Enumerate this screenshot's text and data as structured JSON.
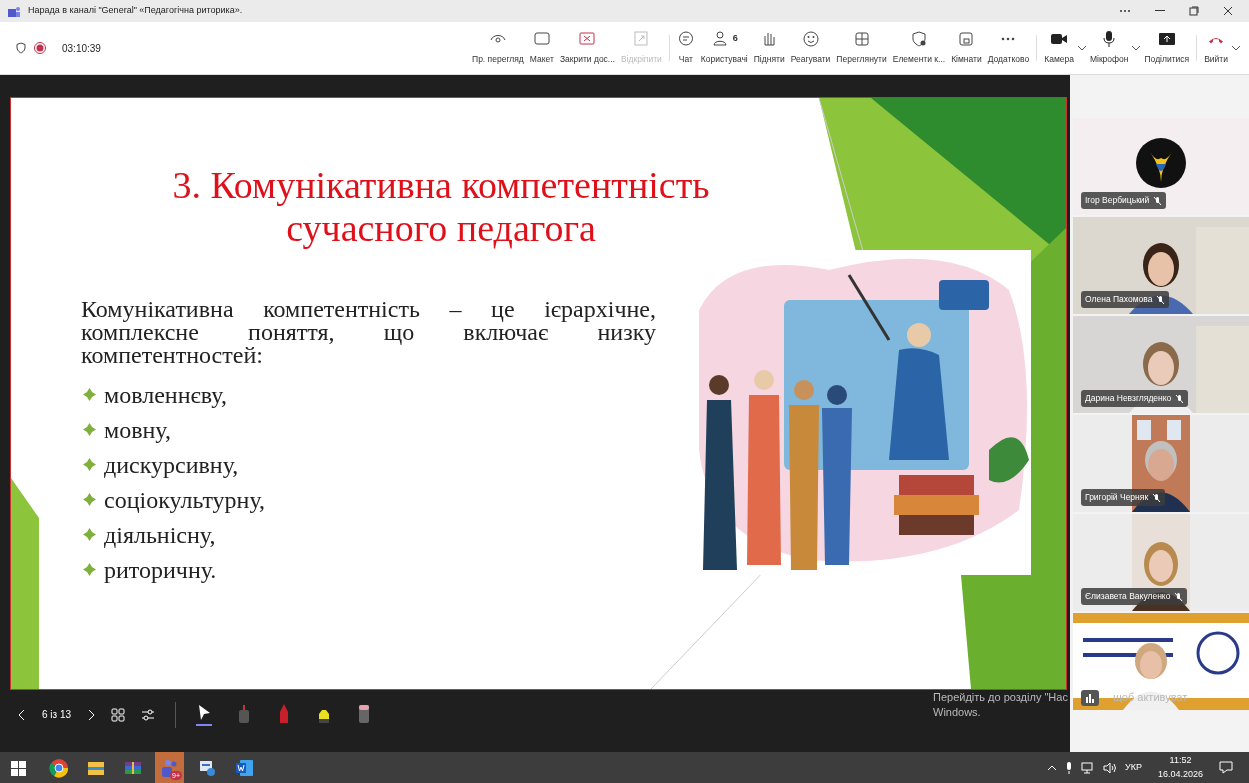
{
  "window": {
    "title": "Нарада в каналі \"General\" «Педагогічна риторика»."
  },
  "meeting": {
    "timer": "03:10:39",
    "recording": true
  },
  "toolbar": [
    {
      "kind": "eye",
      "label": "Пр. перегляд",
      "disabled": false,
      "menu": false
    },
    {
      "kind": "layout",
      "label": "Макет",
      "disabled": false,
      "menu": false
    },
    {
      "kind": "stop-share",
      "label": "Закрити дос...",
      "disabled": false,
      "menu": false
    },
    {
      "kind": "unpin",
      "label": "Відкріпити",
      "disabled": true,
      "menu": false
    },
    {
      "kind": "chat",
      "label": "Чат",
      "disabled": false,
      "menu": false
    },
    {
      "kind": "people",
      "label": "Користувачі",
      "count": "6",
      "disabled": false,
      "menu": false
    },
    {
      "kind": "hand",
      "label": "Підняти",
      "disabled": false,
      "menu": false
    },
    {
      "kind": "smile",
      "label": "Реагувати",
      "disabled": false,
      "menu": false
    },
    {
      "kind": "grid",
      "label": "Переглянути",
      "disabled": false,
      "menu": false
    },
    {
      "kind": "shield",
      "label": "Елементи к...",
      "disabled": false,
      "menu": false
    },
    {
      "kind": "rooms",
      "label": "Кімнати",
      "disabled": false,
      "menu": false
    },
    {
      "kind": "more",
      "label": "Додатково",
      "disabled": false,
      "menu": false
    },
    {
      "kind": "camera",
      "label": "Камера",
      "disabled": false,
      "menu": true
    },
    {
      "kind": "mic",
      "label": "Мікрофон",
      "disabled": false,
      "menu": true
    },
    {
      "kind": "share",
      "label": "Поділитися",
      "disabled": false,
      "menu": false
    },
    {
      "kind": "leave",
      "label": "Вийти",
      "disabled": false,
      "menu": true
    }
  ],
  "slide": {
    "title_lines": [
      "3. Комунікативна компетентність",
      "сучасного педагога"
    ],
    "intro": "Комунікативна компетентність – це ієрархічне, комплексне поняття, що включає низку компетентностей:",
    "bullets": [
      "мовленнєву,",
      "мовну,",
      "дискурсивну,",
      "соціокультурну,",
      "діяльнісну,",
      "риторичну."
    ]
  },
  "presenter_bar": {
    "page": "6 із 13",
    "tools": [
      {
        "kind": "pointer",
        "selected": true
      },
      {
        "kind": "laser",
        "selected": false
      },
      {
        "kind": "pen",
        "selected": false
      },
      {
        "kind": "highlighter",
        "selected": false
      },
      {
        "kind": "eraser",
        "selected": false
      }
    ]
  },
  "participants": [
    {
      "kind": "avatar",
      "name": "Ігор Вербицький",
      "muted": true
    },
    {
      "kind": "video",
      "name": "Олена Пахомова",
      "muted": true
    },
    {
      "kind": "video",
      "name": "Дарина Невзгляденко",
      "muted": true
    },
    {
      "kind": "narrow",
      "name": "Григорій Черняк",
      "muted": true
    },
    {
      "kind": "narrow",
      "name": "Єлизавета Вакуленко",
      "muted": true
    },
    {
      "kind": "banner",
      "muted": false
    }
  ],
  "activation": {
    "line_1": "Перейдіть до розділу \"Нас",
    "line_1_tail": "щоб активуват",
    "line_2": "Windows."
  },
  "taskbar": {
    "apps": [
      {
        "kind": "start",
        "selected": false
      },
      {
        "kind": "browser",
        "selected": false
      },
      {
        "kind": "folder",
        "selected": false
      },
      {
        "kind": "archive",
        "selected": false
      },
      {
        "kind": "teams",
        "selected": true,
        "badge": "9+"
      },
      {
        "kind": "network-app",
        "selected": false
      },
      {
        "kind": "word",
        "selected": false
      }
    ],
    "language": "УКР",
    "time": "11:52",
    "date": "16.04.2026"
  }
}
